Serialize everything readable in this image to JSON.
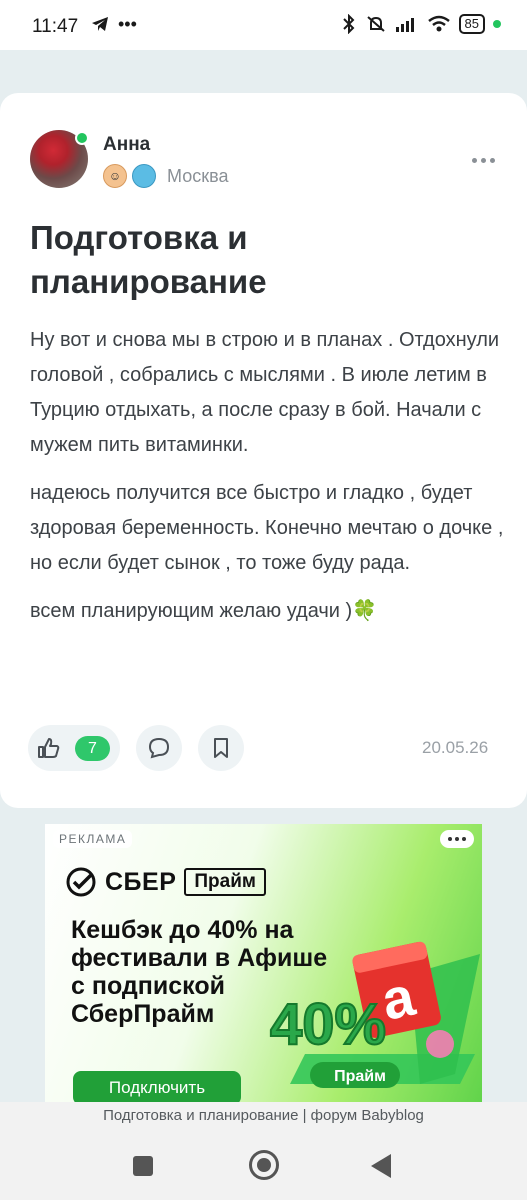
{
  "status_bar": {
    "time": "11:47",
    "left_icons": [
      "telegram-icon",
      "more-dots-icon"
    ],
    "right_icons": [
      "bluetooth-icon",
      "mute-icon",
      "signal-icon",
      "wifi-icon"
    ],
    "battery": "85"
  },
  "post": {
    "author": {
      "name": "Анна",
      "city": "Москва"
    },
    "title": "Подготовка и планирование",
    "paragraphs": [
      "Ну вот и снова мы в строю и в планах . Отдохнули головой , собрались с мыслями . В июле летим в Турцию отдыхать, а после сразу в бой. Начали с мужем пить витаминки.",
      "надеюсь получится все быстро и гладко , будет здоровая беременность. Конечно мечтаю о дочке , но если будет сынок , то тоже буду рада.",
      "всем планирующим желаю удачи )🍀"
    ],
    "likes": "7",
    "date": "20.05.26"
  },
  "ad": {
    "label": "РЕКЛАМА",
    "brand": "СБЕР",
    "brand_tag": "Прайм",
    "headline": "Кешбэк до 40% на фестивали в Афише с подпиской СберПрайм",
    "graphic_text": "40%",
    "graphic_badge": "Прайм",
    "cta": "Подключить",
    "colors": {
      "green": "#21a038",
      "accent_red": "#e5322d"
    }
  },
  "page_caption": "Подготовка и планирование | форум Babyblog",
  "colors": {
    "like_badge": "#2fc76b",
    "online": "#22c55e",
    "muted": "#8a9096"
  }
}
